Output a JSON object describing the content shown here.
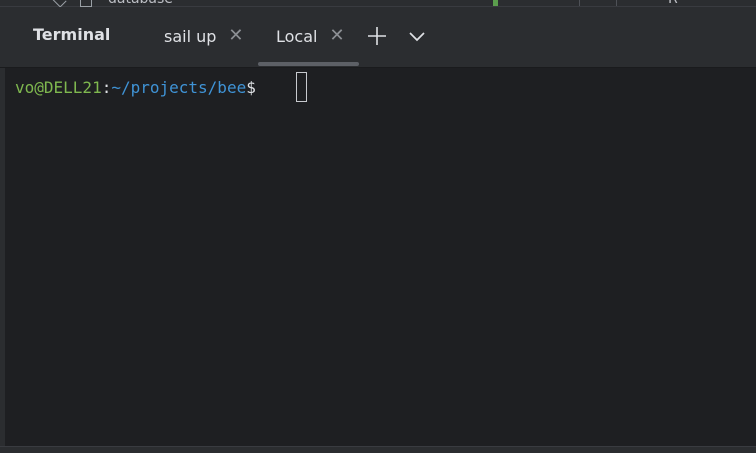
{
  "background_peek": {
    "folder_label": "database",
    "right_label": "R"
  },
  "panel": {
    "title": "Terminal"
  },
  "tabs": [
    {
      "label": "sail up",
      "active": false
    },
    {
      "label": "Local",
      "active": true
    }
  ],
  "actions": {
    "add_icon": "plus-icon",
    "dropdown_icon": "chevron-down-icon"
  },
  "prompt": {
    "user_host": "vo@DELL21",
    "separator": ":",
    "path": "~/projects/bee",
    "symbol": "$"
  },
  "colors": {
    "user_host": "#7fb84f",
    "path": "#3f93d6",
    "text": "#dfe1e5",
    "background": "#1e1f22",
    "toolbar": "#2b2d30"
  }
}
